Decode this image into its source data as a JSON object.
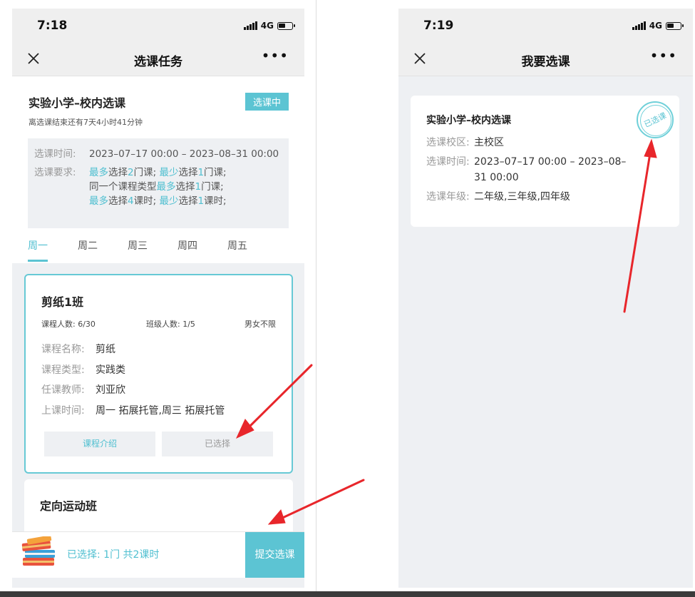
{
  "corner_mark": "",
  "left": {
    "status": {
      "time": "7:18",
      "network": "4G"
    },
    "nav": {
      "title": "选课任务"
    },
    "course": {
      "title": "实验小学–校内选课",
      "badge": "选课中",
      "countdown": "离选课结束还有7天4小时41分钟",
      "time_label": "选课时间:",
      "time_value": "2023–07–17 00:00 – 2023–08–31 00:00",
      "req_label": "选课要求:",
      "req": {
        "l1_a": "最多",
        "l1_b": "选择",
        "l1_c": "2",
        "l1_d": "门课;",
        "l1_e": "最少",
        "l1_f": "选择",
        "l1_g": "1",
        "l1_h": "门课;",
        "l2_a": "同一个课程类型",
        "l2_b": "最多",
        "l2_c": "选择",
        "l2_d": "1",
        "l2_e": "门课;",
        "l3_a": "最多",
        "l3_b": "选择",
        "l3_c": "4",
        "l3_d": "课时;",
        "l3_e": "最少",
        "l3_f": "选择",
        "l3_g": "1",
        "l3_h": "课时;"
      }
    },
    "tabs": [
      "周一",
      "周二",
      "周三",
      "周四",
      "周五"
    ],
    "card1": {
      "title": "剪纸1班",
      "course_count": "课程人数: 6/30",
      "class_count": "班级人数: 1/5",
      "gender": "男女不限",
      "name_label": "课程名称:",
      "name_value": "剪纸",
      "type_label": "课程类型:",
      "type_value": "实践类",
      "teacher_label": "任课教师:",
      "teacher_value": "刘亚欣",
      "schedule_label": "上课时间:",
      "schedule_value": "周一 拓展托管,周三 拓展托管",
      "intro_button": "课程介绍",
      "selected_button": "已选择"
    },
    "card2": {
      "title": "定向运动班"
    },
    "bottom": {
      "summary": "已选择: 1门 共2课时",
      "submit": "提交选课"
    }
  },
  "right": {
    "status": {
      "time": "7:19",
      "network": "4G"
    },
    "nav": {
      "title": "我要选课"
    },
    "card": {
      "title": "实验小学–校内选课",
      "campus_label": "选课校区:",
      "campus_value": "主校区",
      "time_label": "选课时间:",
      "time_value": "2023–07–17 00:00 – 2023–08–31 00:00",
      "grade_label": "选课年级:",
      "grade_value": "二年级,三年级,四年级",
      "stamp": "已选课"
    }
  },
  "colors": {
    "accent": "#5cc4d3",
    "arrow": "#e8262b"
  }
}
